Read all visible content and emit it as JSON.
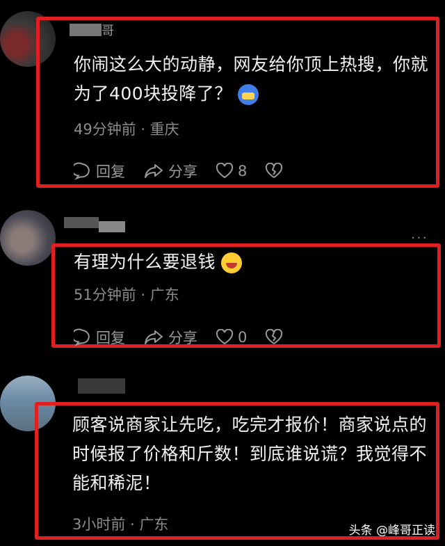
{
  "comments": [
    {
      "username": "哥",
      "text": "你闹这么大的动静，网友给你顶上热搜，你就为了400块投降了？",
      "emoji": "cover-face-emoji",
      "time": "49分钟前",
      "location": "重庆",
      "reply_label": "回复",
      "share_label": "分享",
      "like_count": "8"
    },
    {
      "text": "有理为什么要退钱",
      "emoji": "laugh-cry-emoji",
      "time": "51分钟前",
      "location": "广东",
      "reply_label": "回复",
      "share_label": "分享",
      "like_count": "0"
    },
    {
      "text": "顾客说商家让先吃，吃完才报价！商家说点的时候报了价格和斤数！到底谁说谎？我觉得不能和稀泥！",
      "time": "3小时前",
      "location": "广东"
    }
  ],
  "separator": "·",
  "more_label": "···",
  "watermark": "头条 @峰哥正读",
  "colors": {
    "highlight_border": "#e02020",
    "background": "#000000"
  }
}
